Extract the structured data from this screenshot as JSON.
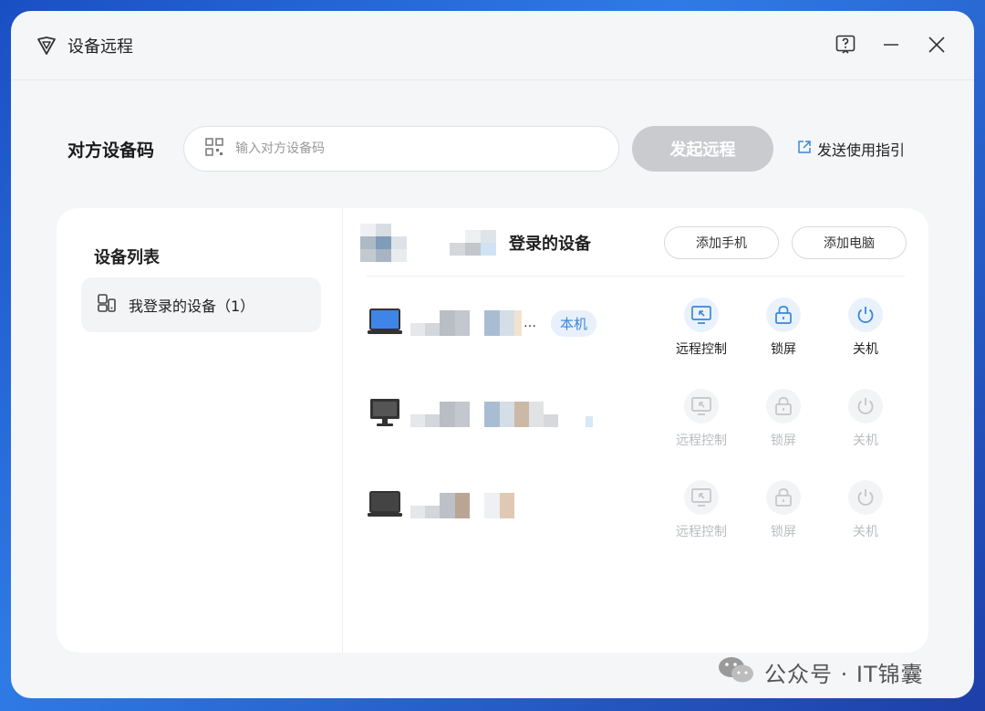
{
  "window": {
    "title": "设备远程"
  },
  "code_bar": {
    "label": "对方设备码",
    "placeholder": "输入对方设备码",
    "start_button": "发起远程",
    "guide_link": "发送使用指引"
  },
  "sidebar": {
    "title": "设备列表",
    "items": [
      {
        "label": "我登录的设备（1）"
      }
    ]
  },
  "main": {
    "title": "登录的设备",
    "add_phone": "添加手机",
    "add_pc": "添加电脑",
    "devices": [
      {
        "type": "laptop",
        "ellipsis": "…",
        "badge": "本机",
        "enabled": true
      },
      {
        "type": "desktop",
        "enabled": false
      },
      {
        "type": "laptop",
        "enabled": false
      }
    ],
    "actions": {
      "remote": "远程控制",
      "lock": "锁屏",
      "shutdown": "关机"
    }
  },
  "watermark": {
    "text": "公众号 · IT锦囊"
  },
  "colors": {
    "accent": "#3a86d7",
    "disabled": "#c9cbcf"
  }
}
